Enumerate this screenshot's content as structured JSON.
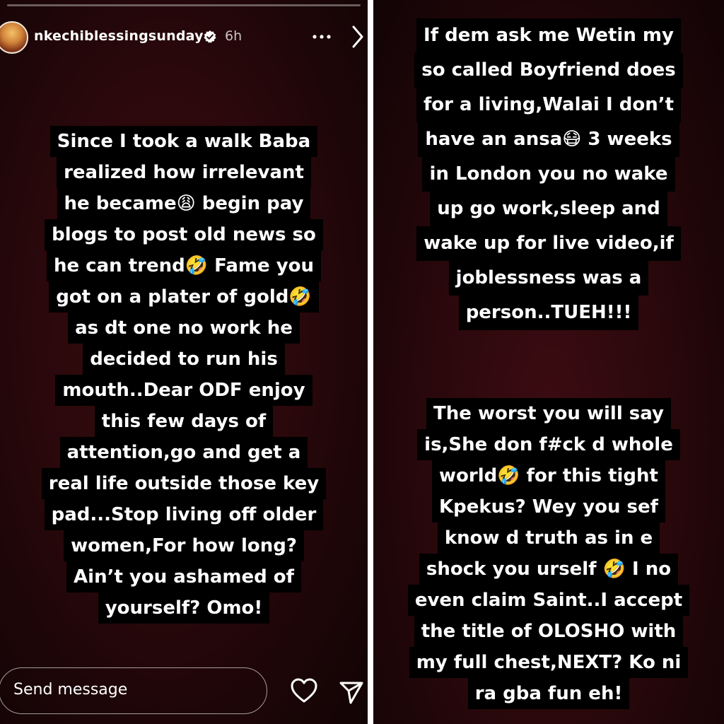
{
  "story": {
    "username": "nkechiblessingsunday",
    "time": "6h",
    "caption_lines": [
      "Since I took a walk Baba",
      "realized how irrelevant",
      "he became😩 begin pay",
      "blogs to post old news so",
      "he can trend🤣 Fame you",
      "got on a plater of gold🤣",
      "as dt one no work he",
      "decided to run his",
      "mouth..Dear ODF enjoy",
      "this few days of",
      "attention,go and get a",
      "real life outside those key",
      "pad...Stop living off older",
      "women,For how long?",
      "Ain’t you ashamed of",
      "yourself? Omo!"
    ]
  },
  "reply": {
    "placeholder": "Send message"
  },
  "second_story": {
    "caption_top_lines": [
      "If dem ask me Wetin my",
      "so called Boyfriend does",
      "for a living,Walai I don’t",
      "have an ansa😷 3 weeks",
      "in London you no wake",
      "up go work,sleep and",
      "wake up for live video,if",
      "joblessness was a",
      "person..TUEH!!!"
    ],
    "caption_bottom_lines": [
      "The worst you will say",
      "is,She don f#ck d whole",
      "world🤣 for this tight",
      "Kpekus? Wey you sef",
      "know d truth as in e",
      "shock you urself 🤣 I no",
      "even claim Saint..I accept",
      "the title of OLOSHO with",
      "my full chest,NEXT? Ko ni",
      "ra gba fun eh!"
    ]
  },
  "icons": {
    "avatar": "profile-photo",
    "verified": "verified-badge-icon",
    "more": "more-options-icon",
    "next": "chevron-right-icon",
    "like": "heart-icon",
    "share": "send-icon"
  },
  "colors": {
    "background": "#2a080b",
    "caption_bg": "#000000",
    "text": "#ffffff"
  }
}
